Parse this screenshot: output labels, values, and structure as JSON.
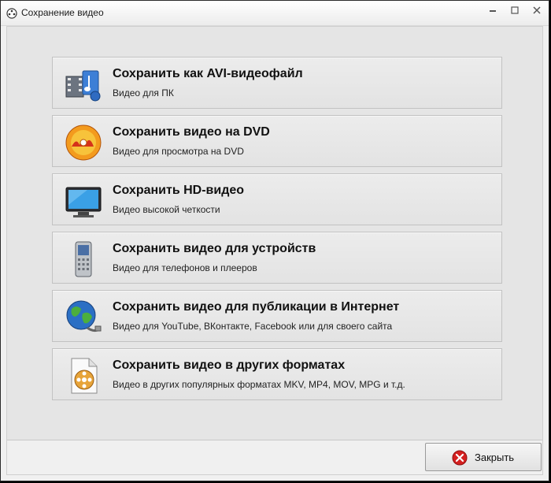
{
  "window": {
    "title": "Сохранение видео"
  },
  "options": [
    {
      "title": "Сохранить как AVI-видеофайл",
      "subtitle": "Видео для ПК",
      "icon": "film-music-icon"
    },
    {
      "title": "Сохранить видео на DVD",
      "subtitle": "Видео для просмотра на DVD",
      "icon": "dvd-disc-icon"
    },
    {
      "title": "Сохранить HD-видео",
      "subtitle": "Видео высокой четкости",
      "icon": "tv-monitor-icon"
    },
    {
      "title": "Сохранить видео для устройств",
      "subtitle": "Видео для телефонов и плееров",
      "icon": "mobile-phone-icon"
    },
    {
      "title": "Сохранить видео для публикации в Интернет",
      "subtitle": "Видео для YouTube, ВКонтакте, Facebook или для своего сайта",
      "icon": "globe-cable-icon"
    },
    {
      "title": "Сохранить видео в других форматах",
      "subtitle": "Видео в других популярных форматах MKV, MP4, MOV, MPG и т.д.",
      "icon": "video-file-icon"
    }
  ],
  "footer": {
    "close_label": "Закрыть"
  },
  "colors": {
    "close_red": "#d42020",
    "globe_blue": "#2b6fc4",
    "dvd_orange": "#f07a1a"
  }
}
